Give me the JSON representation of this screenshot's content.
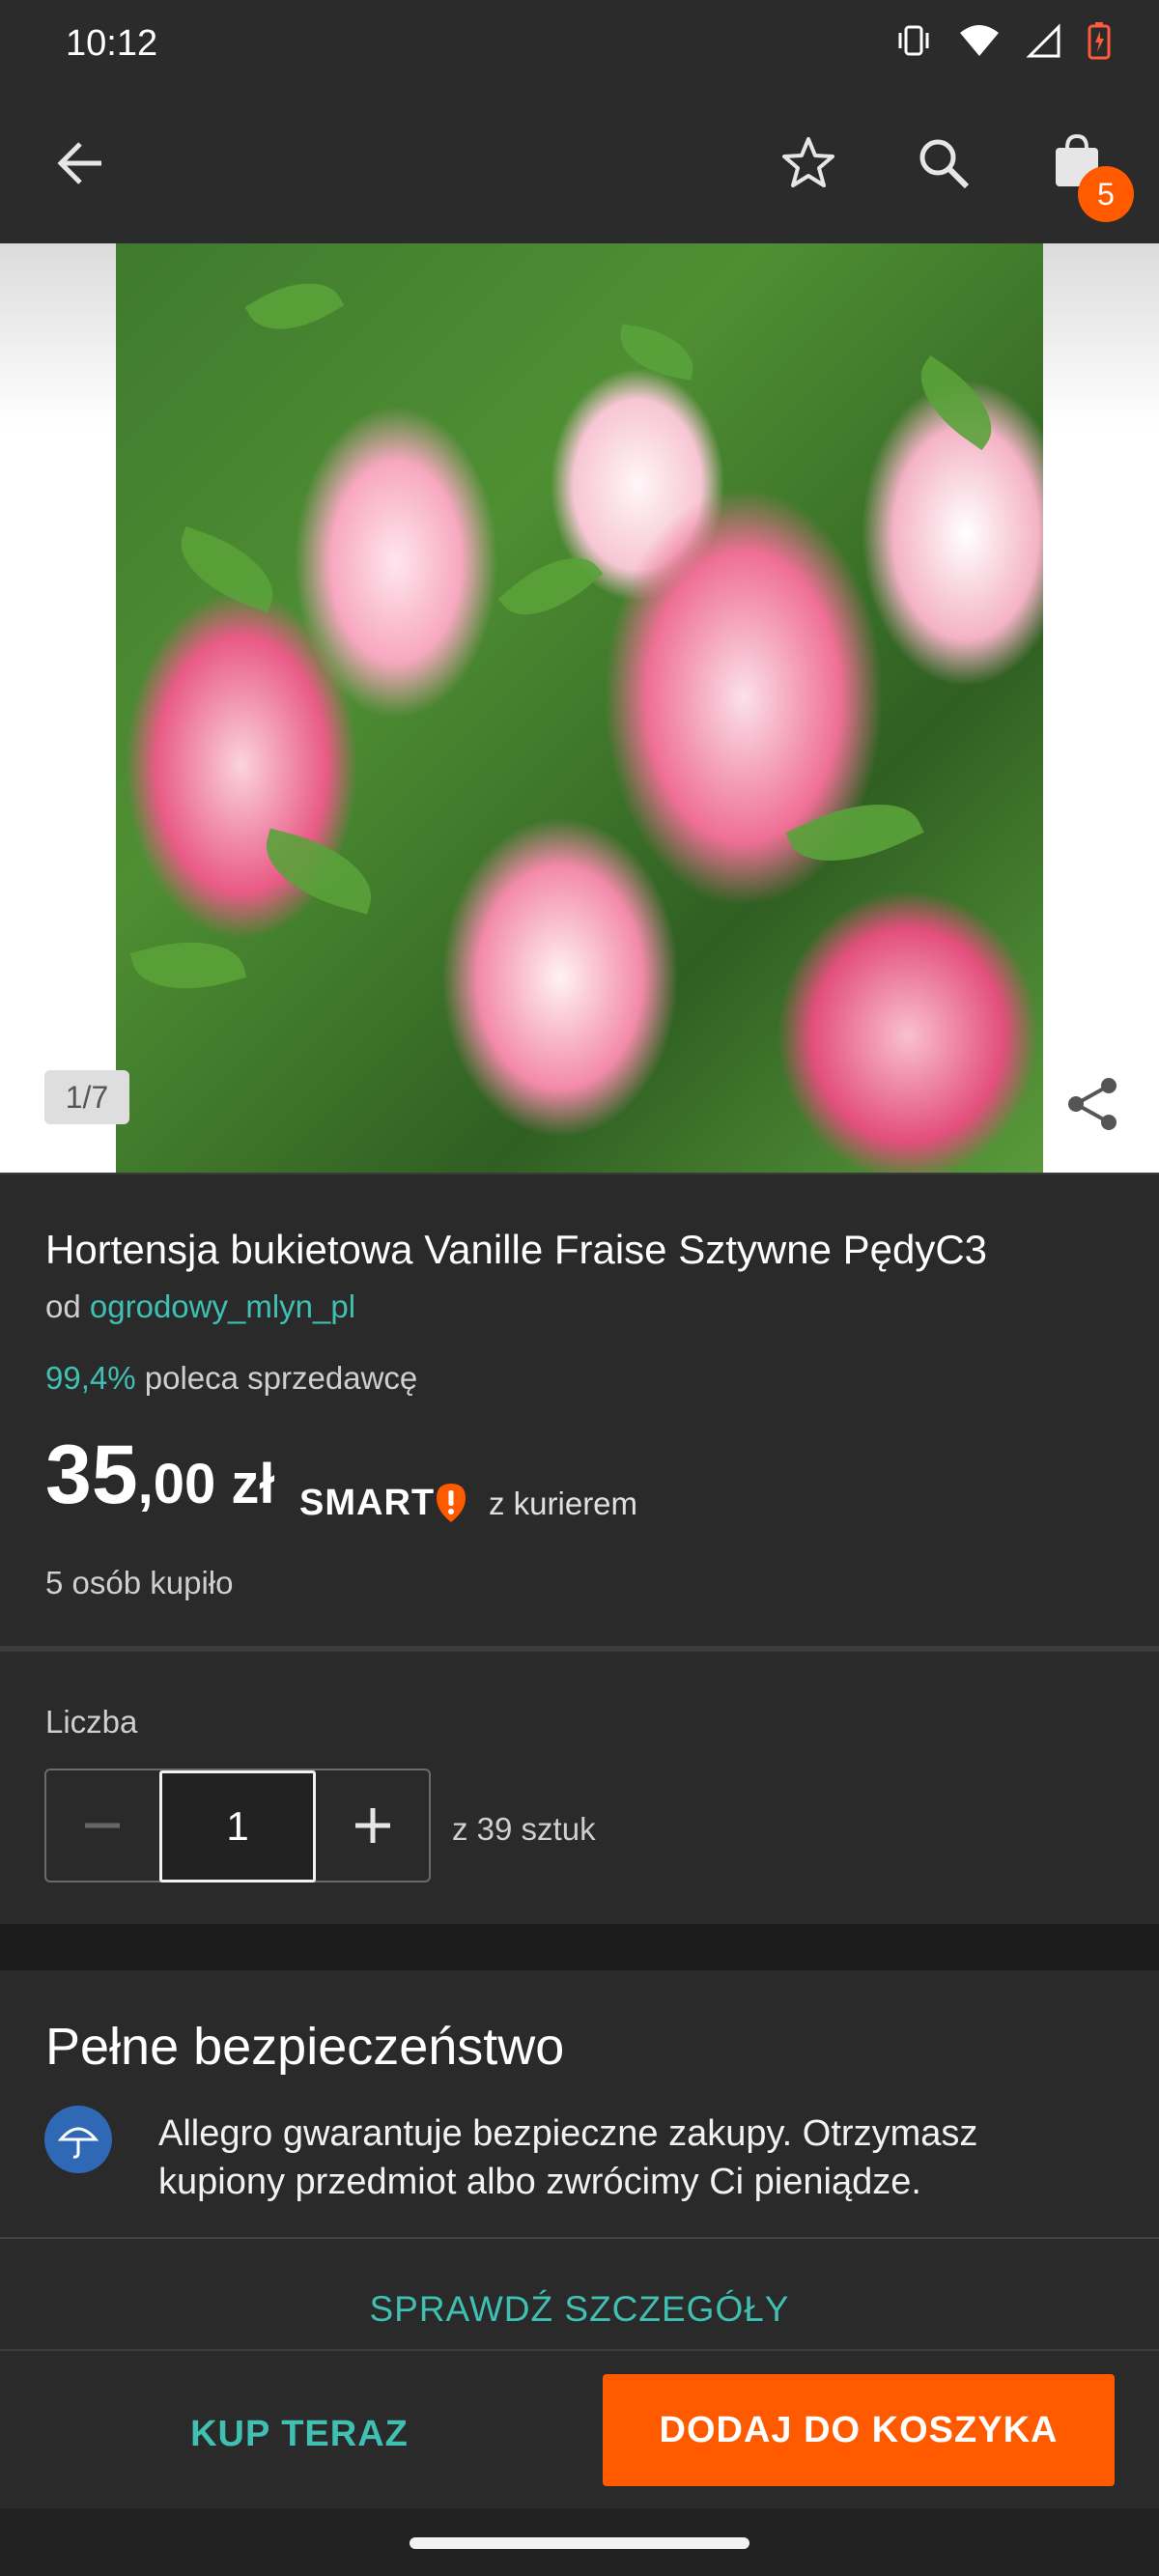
{
  "status_bar": {
    "time": "10:12",
    "icons": [
      "vibrate-icon",
      "wifi-icon",
      "signal-icon",
      "battery-icon"
    ]
  },
  "app_bar": {
    "icons": [
      "back-arrow-icon",
      "star-icon",
      "search-icon",
      "shopping-bag-icon"
    ],
    "cart_count": "5"
  },
  "gallery": {
    "counter": "1/7"
  },
  "product": {
    "title": "Hortensja bukietowa Vanille Fraise Sztywne PędyC3",
    "seller_prefix": "od",
    "seller_name": "ogrodowy_mlyn_pl",
    "recommend_pct": "99,4%",
    "recommend_text": "poleca sprzedawcę",
    "price_integer": "35",
    "price_fraction": ",00 zł",
    "smart_label": "SMART",
    "courier_text": "z kurierem",
    "bought_text": "5 osób kupiło"
  },
  "quantity": {
    "label": "Liczba",
    "value": "1",
    "available": "z 39 sztuk"
  },
  "safety": {
    "title": "Pełne bezpieczeństwo",
    "text": "Allegro gwarantuje bezpieczne zakupy. Otrzymasz kupiony przedmiot albo zwrócimy Ci pieniądze.",
    "details_link": "SPRAWDŹ SZCZEGÓŁY"
  },
  "actions": {
    "buy_now": "KUP TERAZ",
    "add_to_cart": "DODAJ DO KOSZYKA"
  },
  "colors": {
    "accent_teal": "#3fc0b2",
    "accent_orange": "#ff5a00",
    "background": "#222222",
    "surface": "#2a2a2a"
  }
}
